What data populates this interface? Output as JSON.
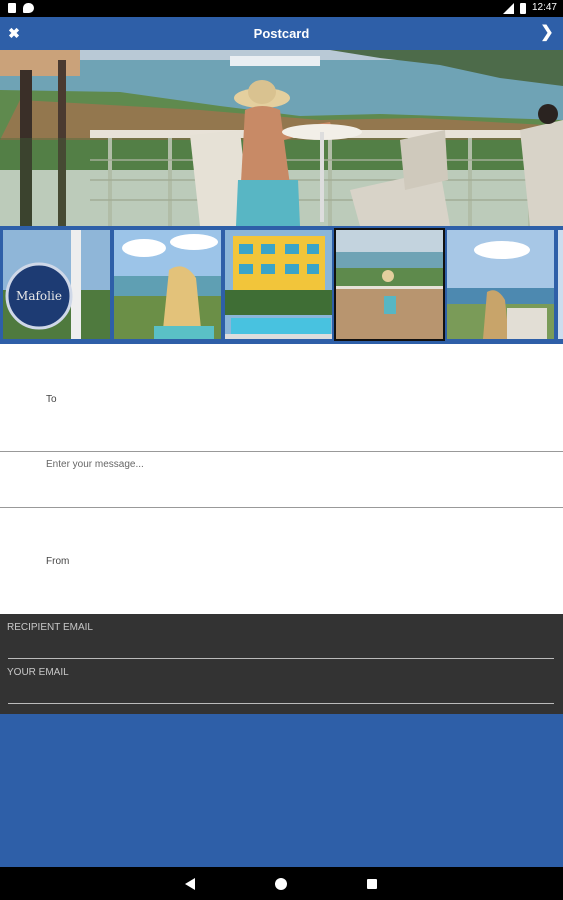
{
  "status_bar": {
    "time": "12:47",
    "icons": [
      "notification-box-icon",
      "chat-bubble-icon",
      "signal-icon",
      "battery-icon"
    ]
  },
  "app_bar": {
    "title": "Postcard",
    "close_icon": "close-icon",
    "next_icon": "chevron-right-icon"
  },
  "hero": {
    "description_icon": "selected-postcard-photo"
  },
  "thumbnails": [
    {
      "name": "thumb-hotel-sign",
      "sign_text": "Mafolie",
      "selected": false
    },
    {
      "name": "thumb-woman-drink",
      "selected": false
    },
    {
      "name": "thumb-yellow-hotel-pool",
      "selected": false
    },
    {
      "name": "thumb-terrace-view",
      "selected": true
    },
    {
      "name": "thumb-harbor-woman",
      "selected": false
    }
  ],
  "form": {
    "to_label": "To",
    "message_placeholder": "Enter your message...",
    "from_label": "From"
  },
  "email": {
    "recipient_label": "RECIPIENT EMAIL",
    "your_label": "YOUR EMAIL"
  },
  "colors": {
    "brand_blue": "#2e5fa8",
    "email_panel": "#333333"
  }
}
